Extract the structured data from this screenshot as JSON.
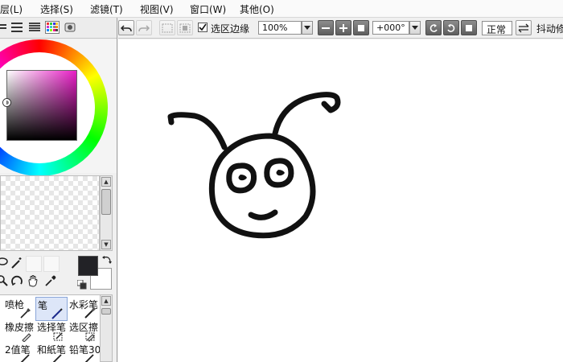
{
  "menu": [
    {
      "label": "层(L)"
    },
    {
      "label": "选择(S)"
    },
    {
      "label": "滤镜(T)"
    },
    {
      "label": "视图(V)"
    },
    {
      "label": "窗口(W)"
    },
    {
      "label": "其他(O)"
    }
  ],
  "colors": {
    "foreground": "#222226",
    "background": "#ffffff",
    "hue": "#e81ec6"
  },
  "brushes": [
    {
      "label": "喷枪",
      "icon": "airbrush-icon",
      "selected": false
    },
    {
      "label": "笔",
      "icon": "pen-icon",
      "selected": true
    },
    {
      "label": "水彩笔",
      "icon": "watercolor-icon",
      "selected": false
    },
    {
      "label": "橡皮擦",
      "icon": "eraser-icon",
      "selected": false
    },
    {
      "label": "选择笔",
      "icon": "select-pen-icon",
      "selected": false
    },
    {
      "label": "选区擦",
      "icon": "select-eraser-icon",
      "selected": false
    },
    {
      "label": "2值笔",
      "icon": "binary-pen-icon",
      "selected": false
    },
    {
      "label": "和紙笔",
      "icon": "washi-icon",
      "selected": false
    },
    {
      "label": "铅笔30",
      "icon": "pencil-icon",
      "selected": false
    }
  ],
  "toolbar": {
    "selection_edge_label": "选区边缘",
    "selection_edge_checked": true,
    "zoom_value": "100%",
    "rotation_value": "+000°",
    "blend_mode": "正常",
    "stabilizer_label": "抖动修"
  }
}
